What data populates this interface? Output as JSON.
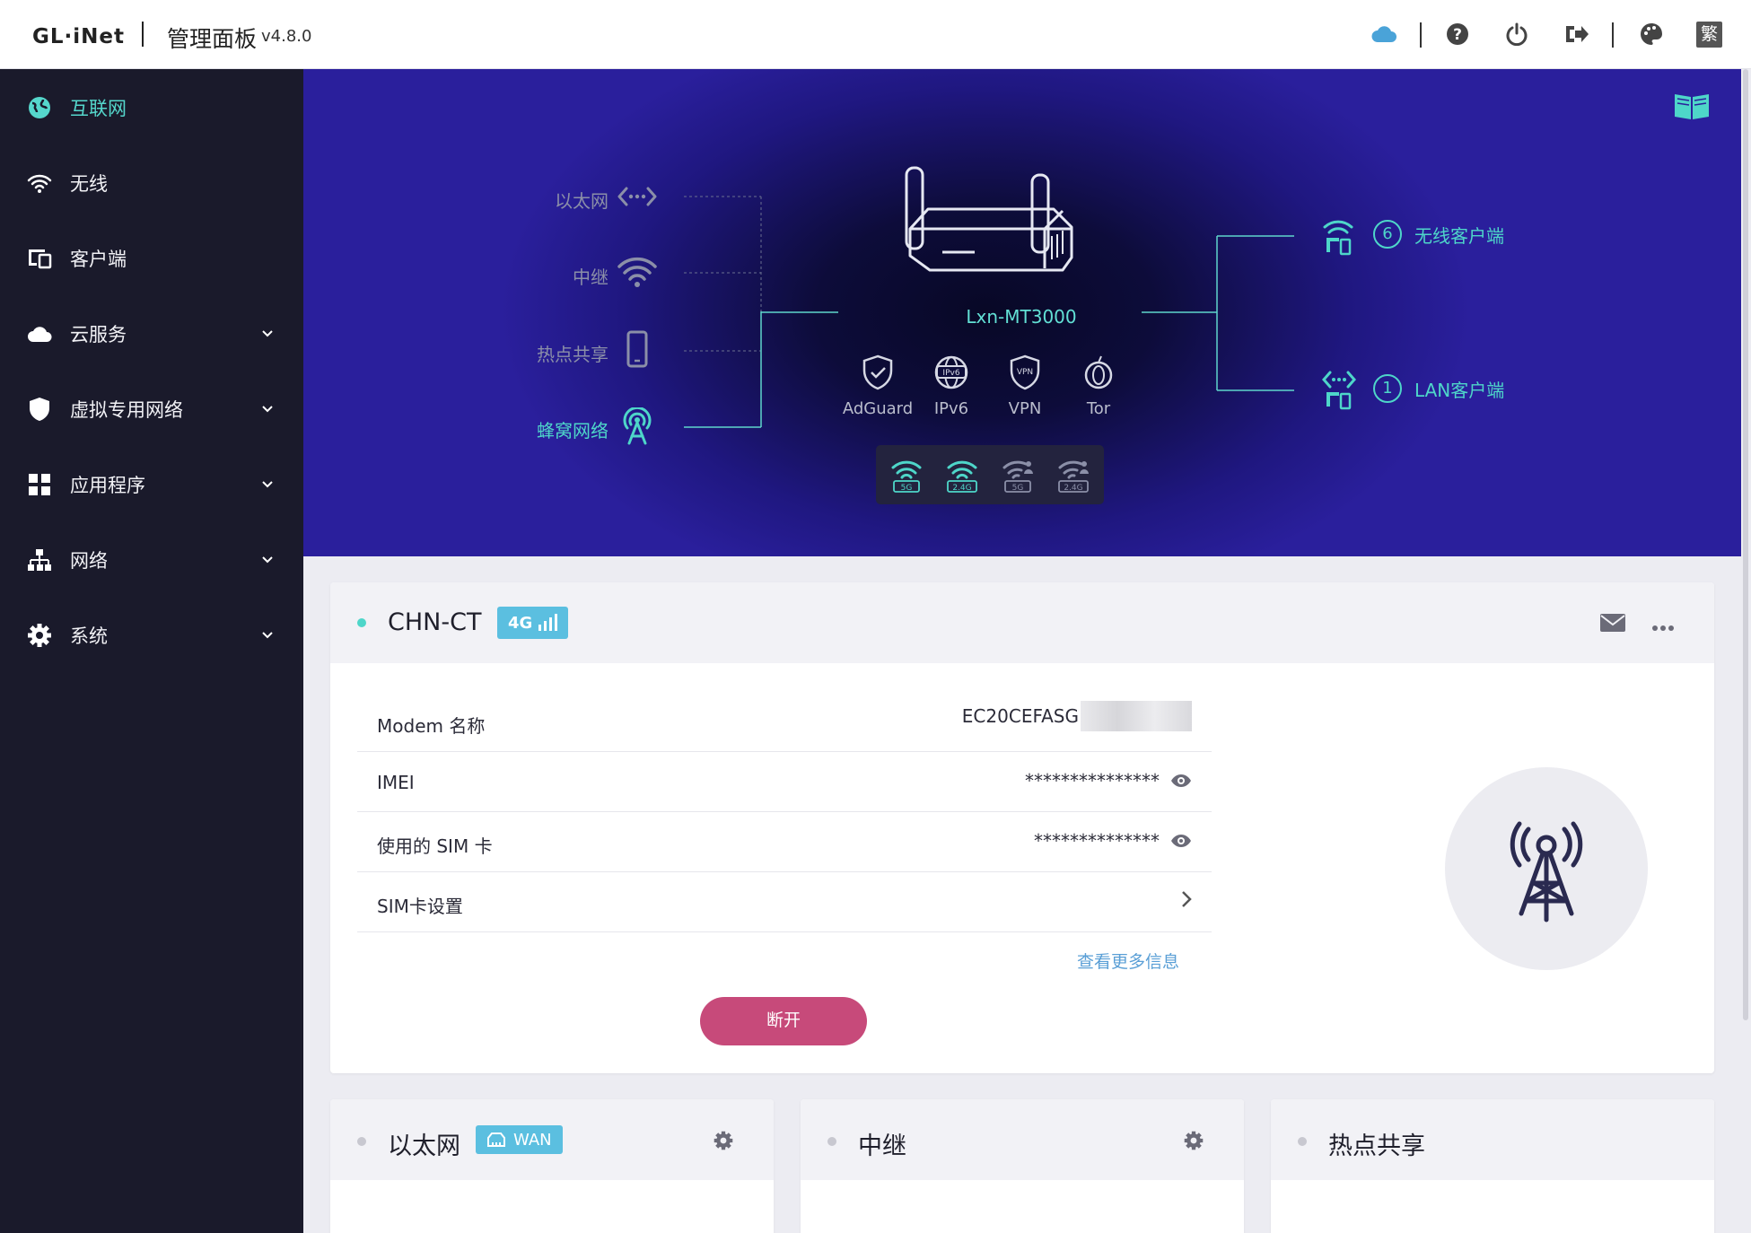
{
  "header": {
    "logo": "GL·iNet",
    "panel_title": "管理面板",
    "version": "v4.8.0",
    "language_button": "繁",
    "icons": [
      "cloud-icon",
      "help-icon",
      "power-icon",
      "logout-icon",
      "palette-icon"
    ]
  },
  "sidebar": {
    "items": [
      {
        "label": "互联网",
        "icon": "globe-icon",
        "active": true,
        "expandable": false
      },
      {
        "label": "无线",
        "icon": "wifi-icon",
        "active": false,
        "expandable": false
      },
      {
        "label": "客户端",
        "icon": "devices-icon",
        "active": false,
        "expandable": false
      },
      {
        "label": "云服务",
        "icon": "cloud-icon",
        "active": false,
        "expandable": true
      },
      {
        "label": "虚拟专用网络",
        "icon": "shield-icon",
        "active": false,
        "expandable": true
      },
      {
        "label": "应用程序",
        "icon": "apps-icon",
        "active": false,
        "expandable": true
      },
      {
        "label": "网络",
        "icon": "network-icon",
        "active": false,
        "expandable": true
      },
      {
        "label": "系统",
        "icon": "gear-icon",
        "active": false,
        "expandable": true
      }
    ]
  },
  "topology": {
    "sources": [
      {
        "label": "以太网",
        "icon": "ethernet-icon",
        "active": false
      },
      {
        "label": "中继",
        "icon": "wifi-icon",
        "active": false
      },
      {
        "label": "热点共享",
        "icon": "phone-icon",
        "active": false
      },
      {
        "label": "蜂窝网络",
        "icon": "cellular-icon",
        "active": true
      }
    ],
    "device_name": "Lxn-MT3000",
    "services": [
      "AdGuard",
      "IPv6",
      "VPN",
      "Tor"
    ],
    "radios": [
      {
        "band": "5G",
        "enabled": true
      },
      {
        "band": "2.4G",
        "enabled": true
      },
      {
        "band": "5G",
        "enabled": false
      },
      {
        "band": "2.4G",
        "enabled": false
      }
    ],
    "clients": [
      {
        "count": "6",
        "label": "无线客户端",
        "icon": "wireless-client-icon"
      },
      {
        "count": "1",
        "label": "LAN客户端",
        "icon": "lan-client-icon"
      }
    ]
  },
  "modem_card": {
    "title": "CHN-CT",
    "badge": "4G",
    "rows": [
      {
        "label": "Modem 名称",
        "value": "EC20CEFASG"
      },
      {
        "label": "IMEI",
        "value": "***************"
      },
      {
        "label": "使用的 SIM 卡",
        "value": "**************"
      },
      {
        "label": "SIM卡设置",
        "value": ""
      }
    ],
    "more_link": "查看更多信息",
    "disconnect_button": "断开"
  },
  "bottom_cards": [
    {
      "title": "以太网",
      "badge": "WAN"
    },
    {
      "title": "中继",
      "badge": ""
    },
    {
      "title": "热点共享",
      "badge": ""
    }
  ],
  "colors": {
    "accent": "#4ed6c9",
    "sidebar_bg": "#1a1a2b",
    "badge": "#5bbfe0",
    "disconnect": "#c74a7a",
    "status_online": "#4ed6c9",
    "status_offline": "#c8c8d0"
  }
}
